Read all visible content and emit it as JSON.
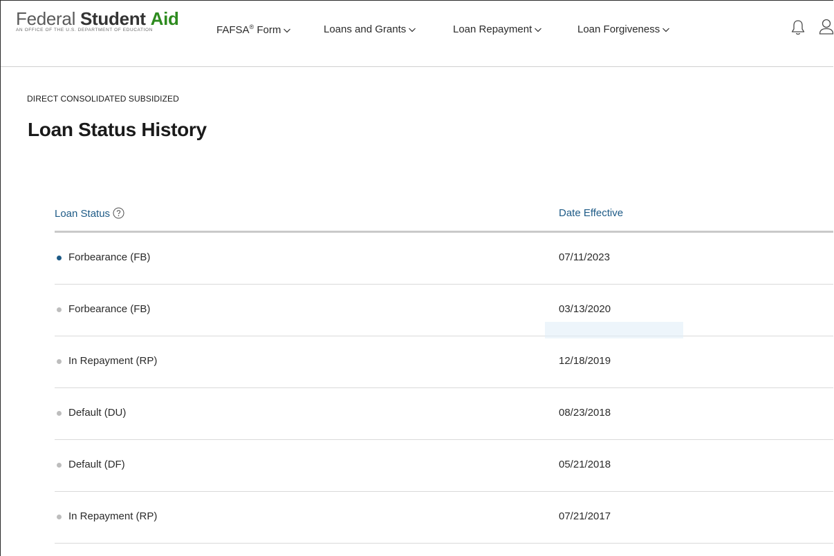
{
  "brand": {
    "federal": "Federal",
    "student": "Student",
    "aid": "Aid",
    "tagline": "An OFFICE of the U.S. DEPARTMENT of EDUCATION"
  },
  "nav": {
    "items": [
      {
        "label": "FAFSA",
        "sup": "®",
        "suffix": " Form"
      },
      {
        "label": "Loans and Grants"
      },
      {
        "label": "Loan Repayment"
      },
      {
        "label": "Loan Forgiveness"
      }
    ],
    "icons": [
      "bell-icon",
      "user-icon"
    ]
  },
  "page": {
    "eyebrow": "DIRECT CONSOLIDATED SUBSIDIZED",
    "title": "Loan Status History"
  },
  "table": {
    "headers": {
      "status": "Loan Status",
      "date": "Date Effective"
    },
    "rows": [
      {
        "status": "Forbearance (FB)",
        "date": "07/11/2023",
        "active": true
      },
      {
        "status": "Forbearance (FB)",
        "date": "03/13/2020",
        "active": false
      },
      {
        "status": "In Repayment (RP)",
        "date": "12/18/2019",
        "active": false
      },
      {
        "status": "Default (DU)",
        "date": "08/23/2018",
        "active": false
      },
      {
        "status": "Default (DF)",
        "date": "05/21/2018",
        "active": false
      },
      {
        "status": "In Repayment (RP)",
        "date": "07/21/2017",
        "active": false
      }
    ]
  },
  "colors": {
    "link_blue": "#1d5a86",
    "brand_green": "#2e8b1f",
    "inactive_dot": "#bdbdbd"
  }
}
